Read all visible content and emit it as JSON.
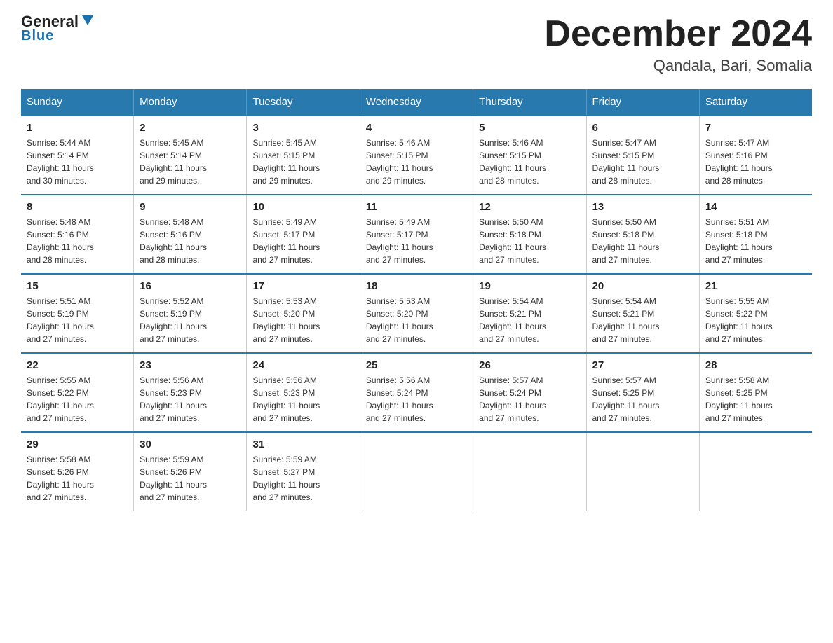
{
  "header": {
    "logo_general": "General",
    "logo_triangle": "▶",
    "logo_blue": "Blue",
    "main_title": "December 2024",
    "subtitle": "Qandala, Bari, Somalia"
  },
  "weekdays": [
    "Sunday",
    "Monday",
    "Tuesday",
    "Wednesday",
    "Thursday",
    "Friday",
    "Saturday"
  ],
  "weeks": [
    [
      {
        "day": "1",
        "sunrise": "5:44 AM",
        "sunset": "5:14 PM",
        "daylight": "11 hours and 30 minutes."
      },
      {
        "day": "2",
        "sunrise": "5:45 AM",
        "sunset": "5:14 PM",
        "daylight": "11 hours and 29 minutes."
      },
      {
        "day": "3",
        "sunrise": "5:45 AM",
        "sunset": "5:15 PM",
        "daylight": "11 hours and 29 minutes."
      },
      {
        "day": "4",
        "sunrise": "5:46 AM",
        "sunset": "5:15 PM",
        "daylight": "11 hours and 29 minutes."
      },
      {
        "day": "5",
        "sunrise": "5:46 AM",
        "sunset": "5:15 PM",
        "daylight": "11 hours and 28 minutes."
      },
      {
        "day": "6",
        "sunrise": "5:47 AM",
        "sunset": "5:15 PM",
        "daylight": "11 hours and 28 minutes."
      },
      {
        "day": "7",
        "sunrise": "5:47 AM",
        "sunset": "5:16 PM",
        "daylight": "11 hours and 28 minutes."
      }
    ],
    [
      {
        "day": "8",
        "sunrise": "5:48 AM",
        "sunset": "5:16 PM",
        "daylight": "11 hours and 28 minutes."
      },
      {
        "day": "9",
        "sunrise": "5:48 AM",
        "sunset": "5:16 PM",
        "daylight": "11 hours and 28 minutes."
      },
      {
        "day": "10",
        "sunrise": "5:49 AM",
        "sunset": "5:17 PM",
        "daylight": "11 hours and 27 minutes."
      },
      {
        "day": "11",
        "sunrise": "5:49 AM",
        "sunset": "5:17 PM",
        "daylight": "11 hours and 27 minutes."
      },
      {
        "day": "12",
        "sunrise": "5:50 AM",
        "sunset": "5:18 PM",
        "daylight": "11 hours and 27 minutes."
      },
      {
        "day": "13",
        "sunrise": "5:50 AM",
        "sunset": "5:18 PM",
        "daylight": "11 hours and 27 minutes."
      },
      {
        "day": "14",
        "sunrise": "5:51 AM",
        "sunset": "5:18 PM",
        "daylight": "11 hours and 27 minutes."
      }
    ],
    [
      {
        "day": "15",
        "sunrise": "5:51 AM",
        "sunset": "5:19 PM",
        "daylight": "11 hours and 27 minutes."
      },
      {
        "day": "16",
        "sunrise": "5:52 AM",
        "sunset": "5:19 PM",
        "daylight": "11 hours and 27 minutes."
      },
      {
        "day": "17",
        "sunrise": "5:53 AM",
        "sunset": "5:20 PM",
        "daylight": "11 hours and 27 minutes."
      },
      {
        "day": "18",
        "sunrise": "5:53 AM",
        "sunset": "5:20 PM",
        "daylight": "11 hours and 27 minutes."
      },
      {
        "day": "19",
        "sunrise": "5:54 AM",
        "sunset": "5:21 PM",
        "daylight": "11 hours and 27 minutes."
      },
      {
        "day": "20",
        "sunrise": "5:54 AM",
        "sunset": "5:21 PM",
        "daylight": "11 hours and 27 minutes."
      },
      {
        "day": "21",
        "sunrise": "5:55 AM",
        "sunset": "5:22 PM",
        "daylight": "11 hours and 27 minutes."
      }
    ],
    [
      {
        "day": "22",
        "sunrise": "5:55 AM",
        "sunset": "5:22 PM",
        "daylight": "11 hours and 27 minutes."
      },
      {
        "day": "23",
        "sunrise": "5:56 AM",
        "sunset": "5:23 PM",
        "daylight": "11 hours and 27 minutes."
      },
      {
        "day": "24",
        "sunrise": "5:56 AM",
        "sunset": "5:23 PM",
        "daylight": "11 hours and 27 minutes."
      },
      {
        "day": "25",
        "sunrise": "5:56 AM",
        "sunset": "5:24 PM",
        "daylight": "11 hours and 27 minutes."
      },
      {
        "day": "26",
        "sunrise": "5:57 AM",
        "sunset": "5:24 PM",
        "daylight": "11 hours and 27 minutes."
      },
      {
        "day": "27",
        "sunrise": "5:57 AM",
        "sunset": "5:25 PM",
        "daylight": "11 hours and 27 minutes."
      },
      {
        "day": "28",
        "sunrise": "5:58 AM",
        "sunset": "5:25 PM",
        "daylight": "11 hours and 27 minutes."
      }
    ],
    [
      {
        "day": "29",
        "sunrise": "5:58 AM",
        "sunset": "5:26 PM",
        "daylight": "11 hours and 27 minutes."
      },
      {
        "day": "30",
        "sunrise": "5:59 AM",
        "sunset": "5:26 PM",
        "daylight": "11 hours and 27 minutes."
      },
      {
        "day": "31",
        "sunrise": "5:59 AM",
        "sunset": "5:27 PM",
        "daylight": "11 hours and 27 minutes."
      },
      null,
      null,
      null,
      null
    ]
  ],
  "labels": {
    "sunrise": "Sunrise:",
    "sunset": "Sunset:",
    "daylight": "Daylight:"
  }
}
